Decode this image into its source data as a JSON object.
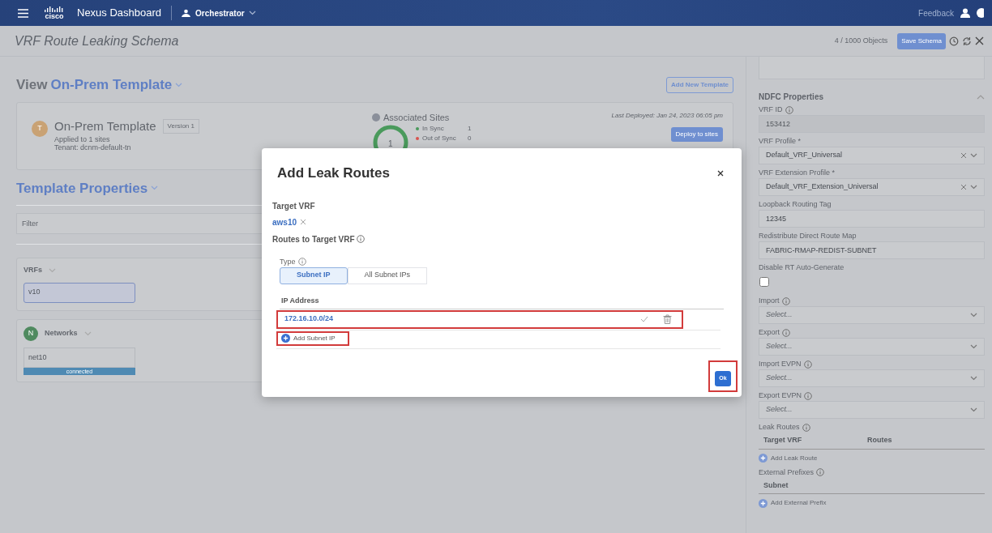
{
  "topbar": {
    "brand": "cisco",
    "app_title": "Nexus Dashboard",
    "service": "Orchestrator",
    "feedback": "Feedback"
  },
  "header": {
    "title": "VRF Route Leaking Schema",
    "object_count": "4 / 1000 Objects",
    "save_button": "Save Schema"
  },
  "template_view": {
    "label": "View",
    "name": "On-Prem Template",
    "add_button": "Add New Template"
  },
  "template_card": {
    "avatar": "T",
    "name": "On-Prem Template",
    "version": "Version 1",
    "applied": "Applied to 1 sites",
    "tenant": "Tenant: dcnm-default-tn",
    "sites_title": "Associated Sites",
    "sites_total": "1",
    "legend": [
      {
        "label": "In Sync",
        "count": "1",
        "color": "#4a9a5c"
      },
      {
        "label": "Out of Sync",
        "count": "0",
        "color": "#d9534f"
      }
    ],
    "last_deployed": "Last Deployed: Jan 24, 2023 06:05 pm",
    "deploy_button": "Deploy to sites"
  },
  "template_properties": {
    "title": "Template Properties",
    "filter_placeholder": "Filter",
    "sections": [
      {
        "title": "VRFs",
        "items": [
          {
            "name": "v10",
            "selected": true
          }
        ]
      },
      {
        "title": "Networks",
        "avatar": "N",
        "items": [
          {
            "name": "net10",
            "selected": false,
            "status": "connected"
          }
        ]
      }
    ]
  },
  "right_panel": {
    "title": "NDFC Properties",
    "expanded": true,
    "fields": [
      {
        "kind": "text",
        "label": "VRF ID",
        "info": true,
        "value": "153412",
        "disabled": true
      },
      {
        "kind": "select",
        "label": "VRF Profile *",
        "info": false,
        "value": "Default_VRF_Universal",
        "clearable": true
      },
      {
        "kind": "select",
        "label": "VRF Extension Profile *",
        "info": false,
        "value": "Default_VRF_Extension_Universal",
        "clearable": true
      },
      {
        "kind": "text",
        "label": "Loopback Routing Tag",
        "info": false,
        "value": "12345",
        "disabled": false
      },
      {
        "kind": "text",
        "label": "Redistribute Direct Route Map",
        "info": false,
        "value": "FABRIC-RMAP-REDIST-SUBNET",
        "disabled": false
      },
      {
        "kind": "checkbox",
        "label": "Disable RT Auto-Generate",
        "info": false,
        "checked": false
      },
      {
        "kind": "select",
        "label": "Import",
        "info": true,
        "placeholder": "Select...",
        "clearable": false
      },
      {
        "kind": "select",
        "label": "Export",
        "info": true,
        "placeholder": "Select...",
        "clearable": false
      },
      {
        "kind": "select",
        "label": "Import EVPN",
        "info": true,
        "placeholder": "Select...",
        "clearable": false
      },
      {
        "kind": "select",
        "label": "Export EVPN",
        "info": true,
        "placeholder": "Select...",
        "clearable": false
      },
      {
        "kind": "table",
        "label": "Leak Routes",
        "info": true,
        "columns": [
          "Target VRF",
          "Routes"
        ],
        "add_label": "Add Leak Route"
      },
      {
        "kind": "table",
        "label": "External Prefixes",
        "info": true,
        "columns": [
          "Subnet"
        ],
        "add_label": "Add External Prefix"
      }
    ]
  },
  "modal": {
    "title": "Add Leak Routes",
    "target_label": "Target VRF",
    "target": "aws10",
    "routes_label": "Routes to Target VRF",
    "type_label": "Type",
    "types": [
      {
        "label": "Subnet IP",
        "selected": true
      },
      {
        "label": "All Subnet IPs",
        "selected": false
      }
    ],
    "column": "IP Address",
    "routes": [
      {
        "ip": "172.16.10.0/24",
        "highlighted": true
      }
    ],
    "add_label": "Add Subnet IP",
    "add_highlighted": true,
    "ok": "Ok",
    "ok_highlighted": true
  }
}
